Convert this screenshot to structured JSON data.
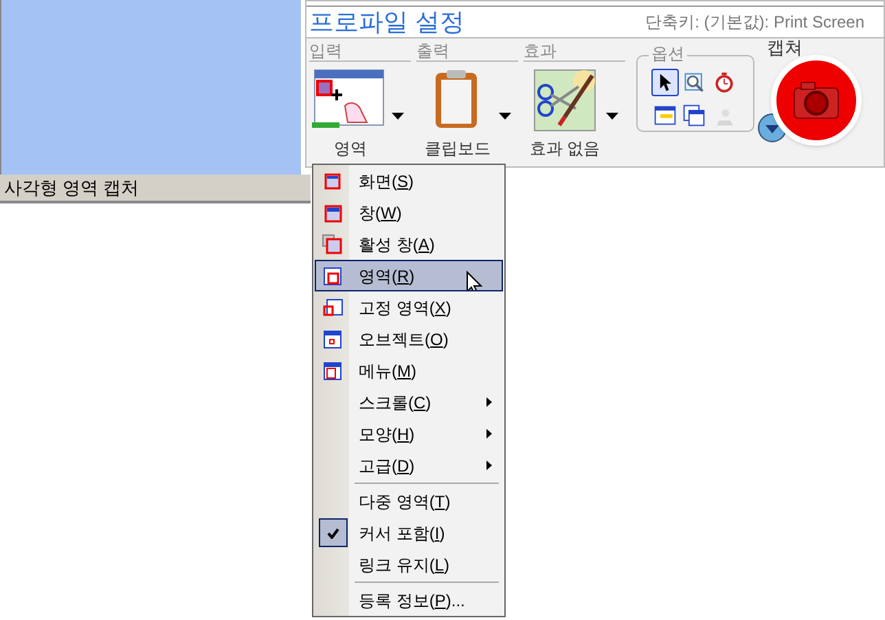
{
  "profile": {
    "title": "프로파일 설정",
    "shortcut": "단축키: (기본값): Print Screen"
  },
  "groups": [
    {
      "label": "입력",
      "button": "영역"
    },
    {
      "label": "출력",
      "button": "클립보드"
    },
    {
      "label": "효과",
      "button": "효과 없음"
    }
  ],
  "options": {
    "label": "옵션",
    "tools": [
      {
        "selected": true
      },
      {
        "selected": false
      },
      {
        "selected": false
      },
      {
        "selected": false
      },
      {
        "selected": false
      },
      {
        "selected": false,
        "disabled": true
      }
    ]
  },
  "capture": {
    "label": "캡쳐"
  },
  "status_bar": "사각형 영역 캡처",
  "menu": [
    {
      "kind": "icon",
      "label": "화면(",
      "key": "S",
      "tail": ")",
      "selected": false
    },
    {
      "kind": "icon",
      "label": "창(",
      "key": "W",
      "tail": ")",
      "selected": false
    },
    {
      "kind": "icon",
      "label": "활성 창(",
      "key": "A",
      "tail": ")",
      "selected": false
    },
    {
      "kind": "icon",
      "label": "영역(",
      "key": "R",
      "tail": ")",
      "selected": true
    },
    {
      "kind": "icon",
      "label": "고정 영역(",
      "key": "X",
      "tail": ")",
      "selected": false
    },
    {
      "kind": "icon",
      "label": "오브젝트(",
      "key": "O",
      "tail": ")",
      "selected": false
    },
    {
      "kind": "icon",
      "label": "메뉴(",
      "key": "M",
      "tail": ")",
      "selected": false
    },
    {
      "kind": "submenu",
      "label": "스크롤(",
      "key": "C",
      "tail": ")",
      "selected": false
    },
    {
      "kind": "submenu",
      "label": "모양(",
      "key": "H",
      "tail": ")",
      "selected": false
    },
    {
      "kind": "submenu",
      "label": "고급(",
      "key": "D",
      "tail": ")",
      "selected": false
    },
    {
      "kind": "separator"
    },
    {
      "kind": "check",
      "label": "다중 영역(",
      "key": "T",
      "tail": ")",
      "selected": false,
      "checked": false
    },
    {
      "kind": "check",
      "label": "커서 포함(",
      "key": "I",
      "tail": ")",
      "selected": false,
      "checked": true
    },
    {
      "kind": "check",
      "label": "링크 유지(",
      "key": "L",
      "tail": ")",
      "selected": false,
      "checked": false
    },
    {
      "kind": "separator"
    },
    {
      "kind": "plain",
      "label": "등록 정보(",
      "key": "P",
      "tail": ")...",
      "selected": false
    }
  ]
}
